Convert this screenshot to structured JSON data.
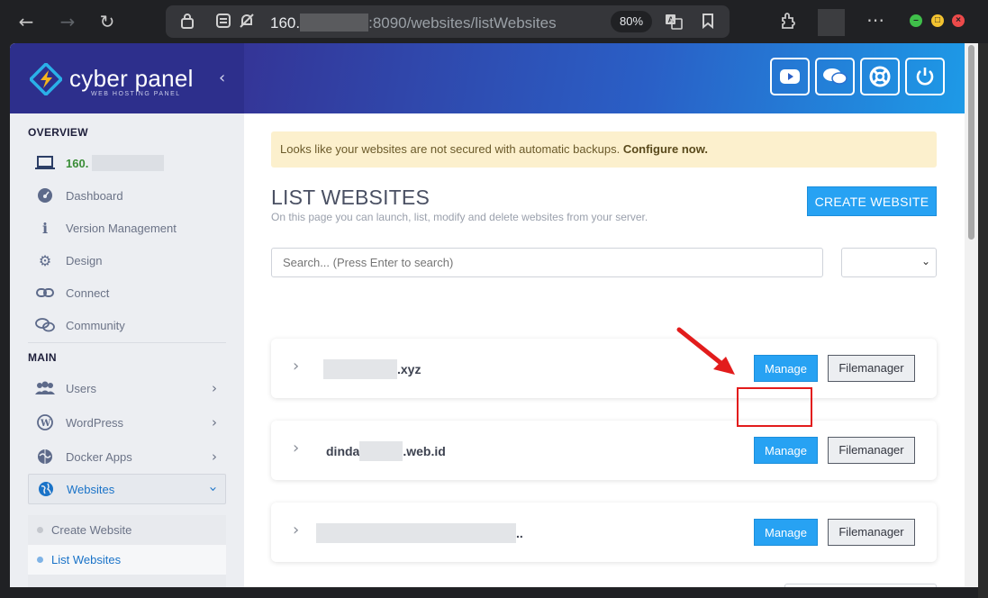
{
  "browser": {
    "url_prefix": "160.",
    "url_suffix": ":8090/websites/listWebsites",
    "zoom": "80%"
  },
  "brand": {
    "name": "cyber panel",
    "tagline": "WEB HOSTING PANEL"
  },
  "sidebar": {
    "overview_title": "OVERVIEW",
    "host_label": "160.",
    "overview_items": [
      {
        "label": "Dashboard",
        "icon": "dashboard-icon"
      },
      {
        "label": "Version Management",
        "icon": "info-icon"
      },
      {
        "label": "Design",
        "icon": "gear-icon"
      },
      {
        "label": "Connect",
        "icon": "link-icon"
      },
      {
        "label": "Community",
        "icon": "chat-icon"
      }
    ],
    "main_title": "MAIN",
    "main_items": [
      {
        "label": "Users",
        "icon": "users-icon"
      },
      {
        "label": "WordPress",
        "icon": "wordpress-icon"
      },
      {
        "label": "Docker Apps",
        "icon": "docker-icon"
      },
      {
        "label": "Websites",
        "icon": "globe-icon"
      }
    ],
    "websites_submenu": [
      {
        "label": "Create Website"
      },
      {
        "label": "List Websites"
      }
    ]
  },
  "header": {
    "buttons": [
      "youtube-icon",
      "chat-bubbles-icon",
      "lifebuoy-icon",
      "power-icon"
    ]
  },
  "main": {
    "alert_text": "Looks like your websites are not secured with automatic backups.",
    "alert_link": "Configure now.",
    "title": "LIST WEBSITES",
    "subtitle": "On this page you can launch, list, modify and delete websites from your server.",
    "create_button": "CREATE WEBSITE",
    "search_placeholder": "Search... (Press Enter to search)",
    "websites": [
      {
        "prefix": "",
        "suffix": ".xyz"
      },
      {
        "prefix": "dinda",
        "suffix": ".web.id"
      },
      {
        "prefix": "",
        "suffix": ".."
      }
    ],
    "manage_label": "Manage",
    "filemanager_label": "Filemanager"
  },
  "annotation": {
    "highlight_color": "#e21c1c"
  }
}
